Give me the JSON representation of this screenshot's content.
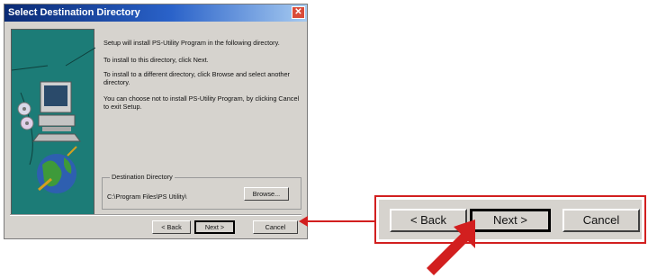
{
  "dialog": {
    "title": "Select Destination Directory",
    "close_glyph": "✕",
    "paragraphs": [
      "Setup will install PS-Utility Program in the following directory.",
      "To install to this directory, click Next.",
      "To install to a different directory, click Browse and select another directory.",
      "You can choose not to install PS-Utility Program, by clicking Cancel to exit Setup."
    ],
    "group_label": "Destination Directory",
    "destination_path": "C:\\Program Files\\PS Utility\\",
    "browse_label": "Browse...",
    "back_label": "< Back",
    "next_label": "Next >",
    "cancel_label": "Cancel"
  },
  "zoom": {
    "back_label": "< Back",
    "next_label": "Next >",
    "cancel_label": "Cancel"
  },
  "colors": {
    "accent_red": "#d21f1f",
    "title_blue": "#0a2a74",
    "art_teal": "#1c7c77"
  }
}
